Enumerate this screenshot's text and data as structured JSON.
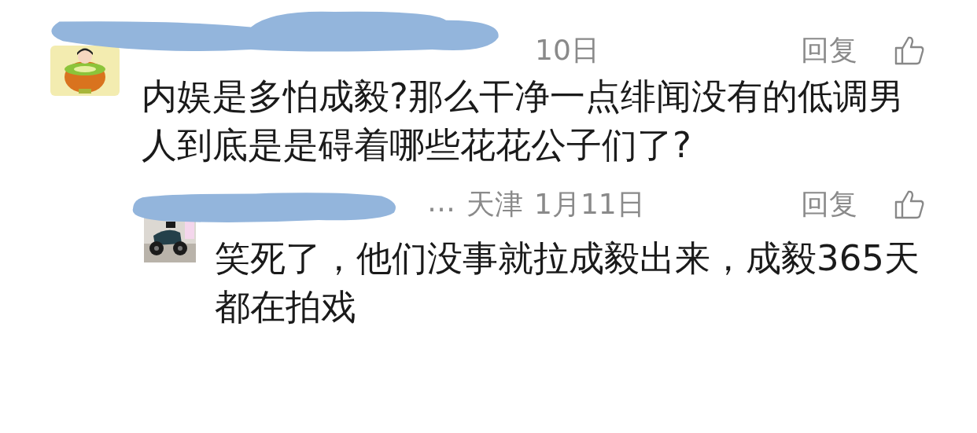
{
  "comments": [
    {
      "meta": [
        "10日"
      ],
      "reply_label": "回复",
      "text": "内娱是多怕成毅?那么干净一点绯闻没有的低调男人到底是是碍着哪些花花公子们了?",
      "replies": [
        {
          "meta": [
            "…",
            "天津",
            "1月11日"
          ],
          "reply_label": "回复",
          "text": "笑死了，他们没事就拉成毅出来，成毅365天都在拍戏"
        }
      ]
    }
  ]
}
